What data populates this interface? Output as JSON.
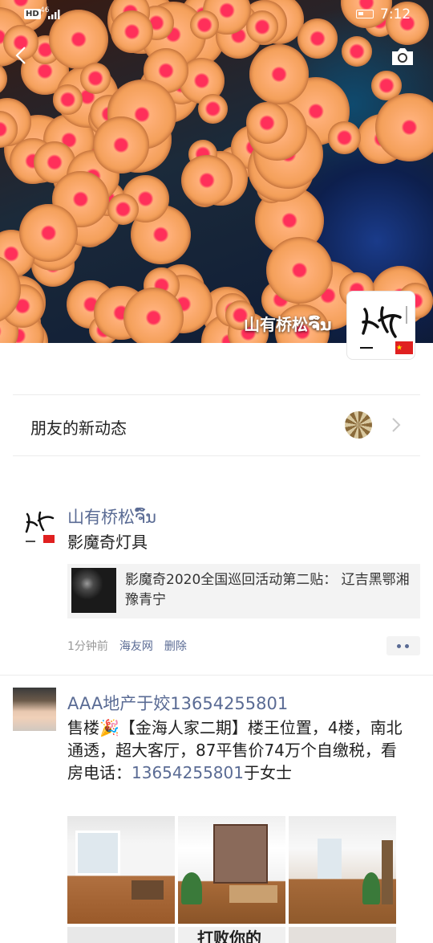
{
  "status_bar": {
    "hd": "HD",
    "network": "46",
    "time": "7:12"
  },
  "cover": {
    "name": "山有桥松ຈົ໌ນ"
  },
  "friends_updates": {
    "label": "朋友的新动态"
  },
  "posts": [
    {
      "author": "山有桥松ຈົ໌ນ",
      "text": "影魔奇灯具",
      "share_title": "影魔奇2020全国巡回活动第二贴： 辽吉黑鄂湘豫青宁",
      "time": "1分钟前",
      "source": "海友网",
      "delete": "删除"
    },
    {
      "author": "AAA地产于姣13654255801",
      "text_before": "售楼🎉【金海人家二期】楼王位置，4楼，南北通透，超大客厅，87平售价74万个自缴税，看房电话：",
      "phone": "13654255801",
      "text_after": "于女士",
      "photo_overlay_text": "打败你的"
    }
  ],
  "colors": {
    "link": "#5a6b94",
    "text": "#222222",
    "meta": "#999999"
  },
  "icons": [
    "back-arrow-icon",
    "camera-icon",
    "chevron-right-icon",
    "more-dots-icon"
  ]
}
